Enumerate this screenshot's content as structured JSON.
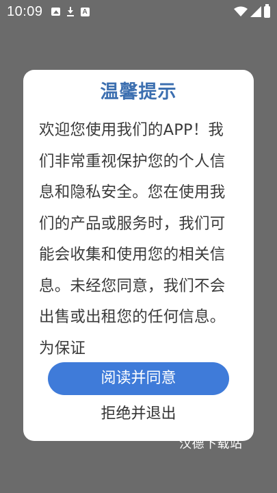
{
  "status_bar": {
    "time": "10:09",
    "left_icons": [
      "image-icon",
      "download-icon",
      "a-icon"
    ],
    "a_icon_letter": "A",
    "right_icons": [
      "wifi-icon",
      "signal-icon",
      "battery-icon"
    ]
  },
  "dialog": {
    "title": "温馨提示",
    "body": "欢迎您使用我们的APP！我们非常重视保护您的个人信息和隐私安全。您在使用我们的产品或服务时，我们可能会收集和使用您的相关信息。未经您同意，我们不会出售或出租您的任何信息。为保证",
    "agree_label": "阅读并同意",
    "reject_label": "拒绝并退出"
  },
  "watermark": "汉德下载站",
  "colors": {
    "backdrop": "#6b6b6b",
    "title": "#3c6fb0",
    "agree_button": "#3f7bd9",
    "dialog_bg": "#ffffff"
  }
}
